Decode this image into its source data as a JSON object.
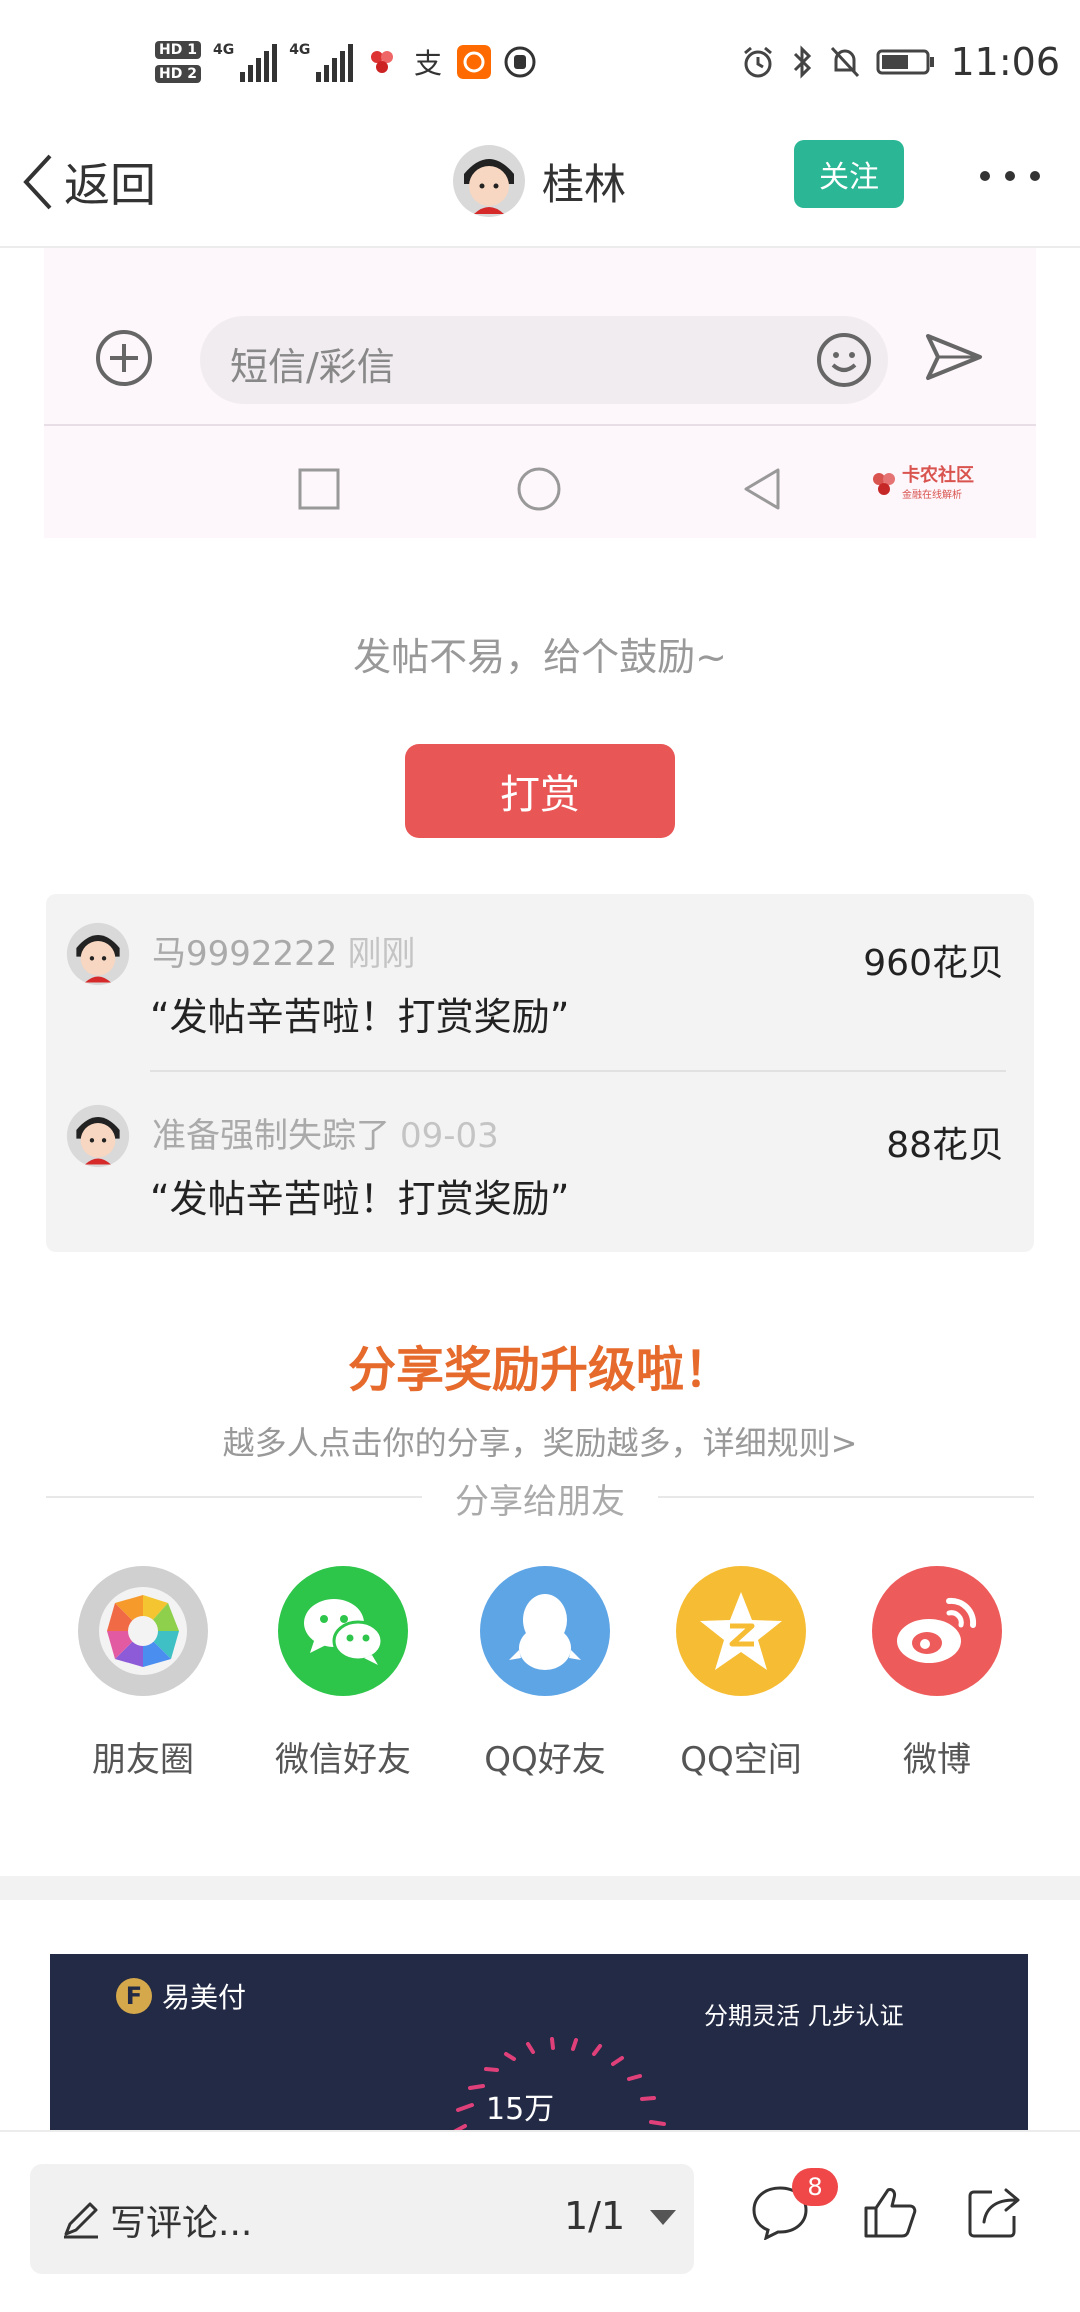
{
  "status_bar": {
    "time": "11:06",
    "hd1": "HD 1",
    "hd2": "HD 2",
    "net1": "4G",
    "net2": "4G"
  },
  "nav": {
    "back_label": "返回",
    "author_name": "桂林",
    "follow_label": "关注"
  },
  "embedded_image": {
    "sms_placeholder": "短信/彩信",
    "watermark": "卡农社区",
    "watermark_sub": "金融在线解析"
  },
  "reward": {
    "prompt": "发帖不易，给个鼓励~",
    "button_label": "打赏",
    "tips": [
      {
        "user": "马9992222",
        "time": "刚刚",
        "message": "“发帖辛苦啦！打赏奖励”",
        "amount": "960花贝"
      },
      {
        "user": "准备强制失踪了",
        "time": "09-03",
        "message": "“发帖辛苦啦！打赏奖励”",
        "amount": "88花贝"
      }
    ]
  },
  "share": {
    "title": "分享奖励升级啦！",
    "subtitle": "越多人点击你的分享，奖励越多，详细规则>",
    "divider_label": "分享给朋友",
    "targets": [
      {
        "label": "朋友圈",
        "color": "#d0d0d0"
      },
      {
        "label": "微信好友",
        "color": "#2dc54a"
      },
      {
        "label": "QQ好友",
        "color": "#5ea5e6"
      },
      {
        "label": "QQ空间",
        "color": "#f6bd34"
      },
      {
        "label": "微博",
        "color": "#ee5b5b"
      }
    ]
  },
  "ad": {
    "brand": "易美付",
    "slogan": "分期灵活 几步认证",
    "amount": "15万"
  },
  "bottom_bar": {
    "comment_placeholder": "写评论...",
    "page_indicator": "1/1",
    "comment_count": "8"
  }
}
